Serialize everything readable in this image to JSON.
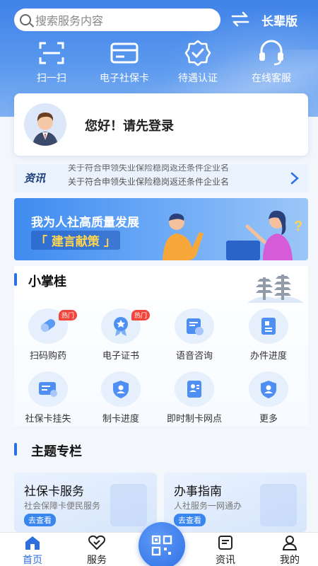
{
  "search": {
    "placeholder": "搜索服务内容"
  },
  "header": {
    "elder_mode": "长辈版"
  },
  "quick_actions": [
    {
      "label": "扫一扫",
      "icon": "scan-icon"
    },
    {
      "label": "电子社保卡",
      "icon": "card-icon"
    },
    {
      "label": "待遇认证",
      "icon": "verify-badge-icon"
    },
    {
      "label": "在线客服",
      "icon": "headset-icon"
    }
  ],
  "login": {
    "text": "您好！请先登录"
  },
  "news": {
    "tag": "资讯",
    "line1": "关于符合申领失业保险稳岗返还条件企业名",
    "line2": "关于符合申领失业保险稳岗返还条件企业名"
  },
  "banner": {
    "title": "我为人社高质量发展",
    "subtitle": "「 建言献策 」"
  },
  "section_xzg": {
    "title": "小掌桂"
  },
  "services": [
    {
      "label": "扫码购药",
      "icon": "medicine-icon",
      "badge": "热门"
    },
    {
      "label": "电子证书",
      "icon": "certificate-icon",
      "badge": "热门"
    },
    {
      "label": "语音咨询",
      "icon": "voice-consult-icon",
      "badge": ""
    },
    {
      "label": "办件进度",
      "icon": "progress-doc-icon",
      "badge": ""
    },
    {
      "label": "社保卡挂失",
      "icon": "card-loss-icon",
      "badge": ""
    },
    {
      "label": "制卡进度",
      "icon": "card-progress-icon",
      "badge": ""
    },
    {
      "label": "即时制卡网点",
      "icon": "card-outlet-icon",
      "badge": ""
    },
    {
      "label": "更多",
      "icon": "more-icon",
      "badge": ""
    }
  ],
  "section_theme": {
    "title": "主题专栏"
  },
  "theme_cards": [
    {
      "title": "社保卡服务",
      "subtitle": "社会保障卡便民服务",
      "button": "去查看"
    },
    {
      "title": "办事指南",
      "subtitle": "人社服务一网通办",
      "button": "去查看"
    }
  ],
  "tabs": [
    {
      "label": "首页",
      "icon": "home-icon",
      "active": true
    },
    {
      "label": "服务",
      "icon": "service-heart-icon",
      "active": false
    },
    {
      "label": "资讯",
      "icon": "news-icon",
      "active": false
    },
    {
      "label": "我的",
      "icon": "user-icon",
      "active": false
    }
  ],
  "colors": {
    "primary": "#2e6fe0",
    "hot_badge": "#f2463c",
    "banner_highlight": "#ffd54f"
  }
}
